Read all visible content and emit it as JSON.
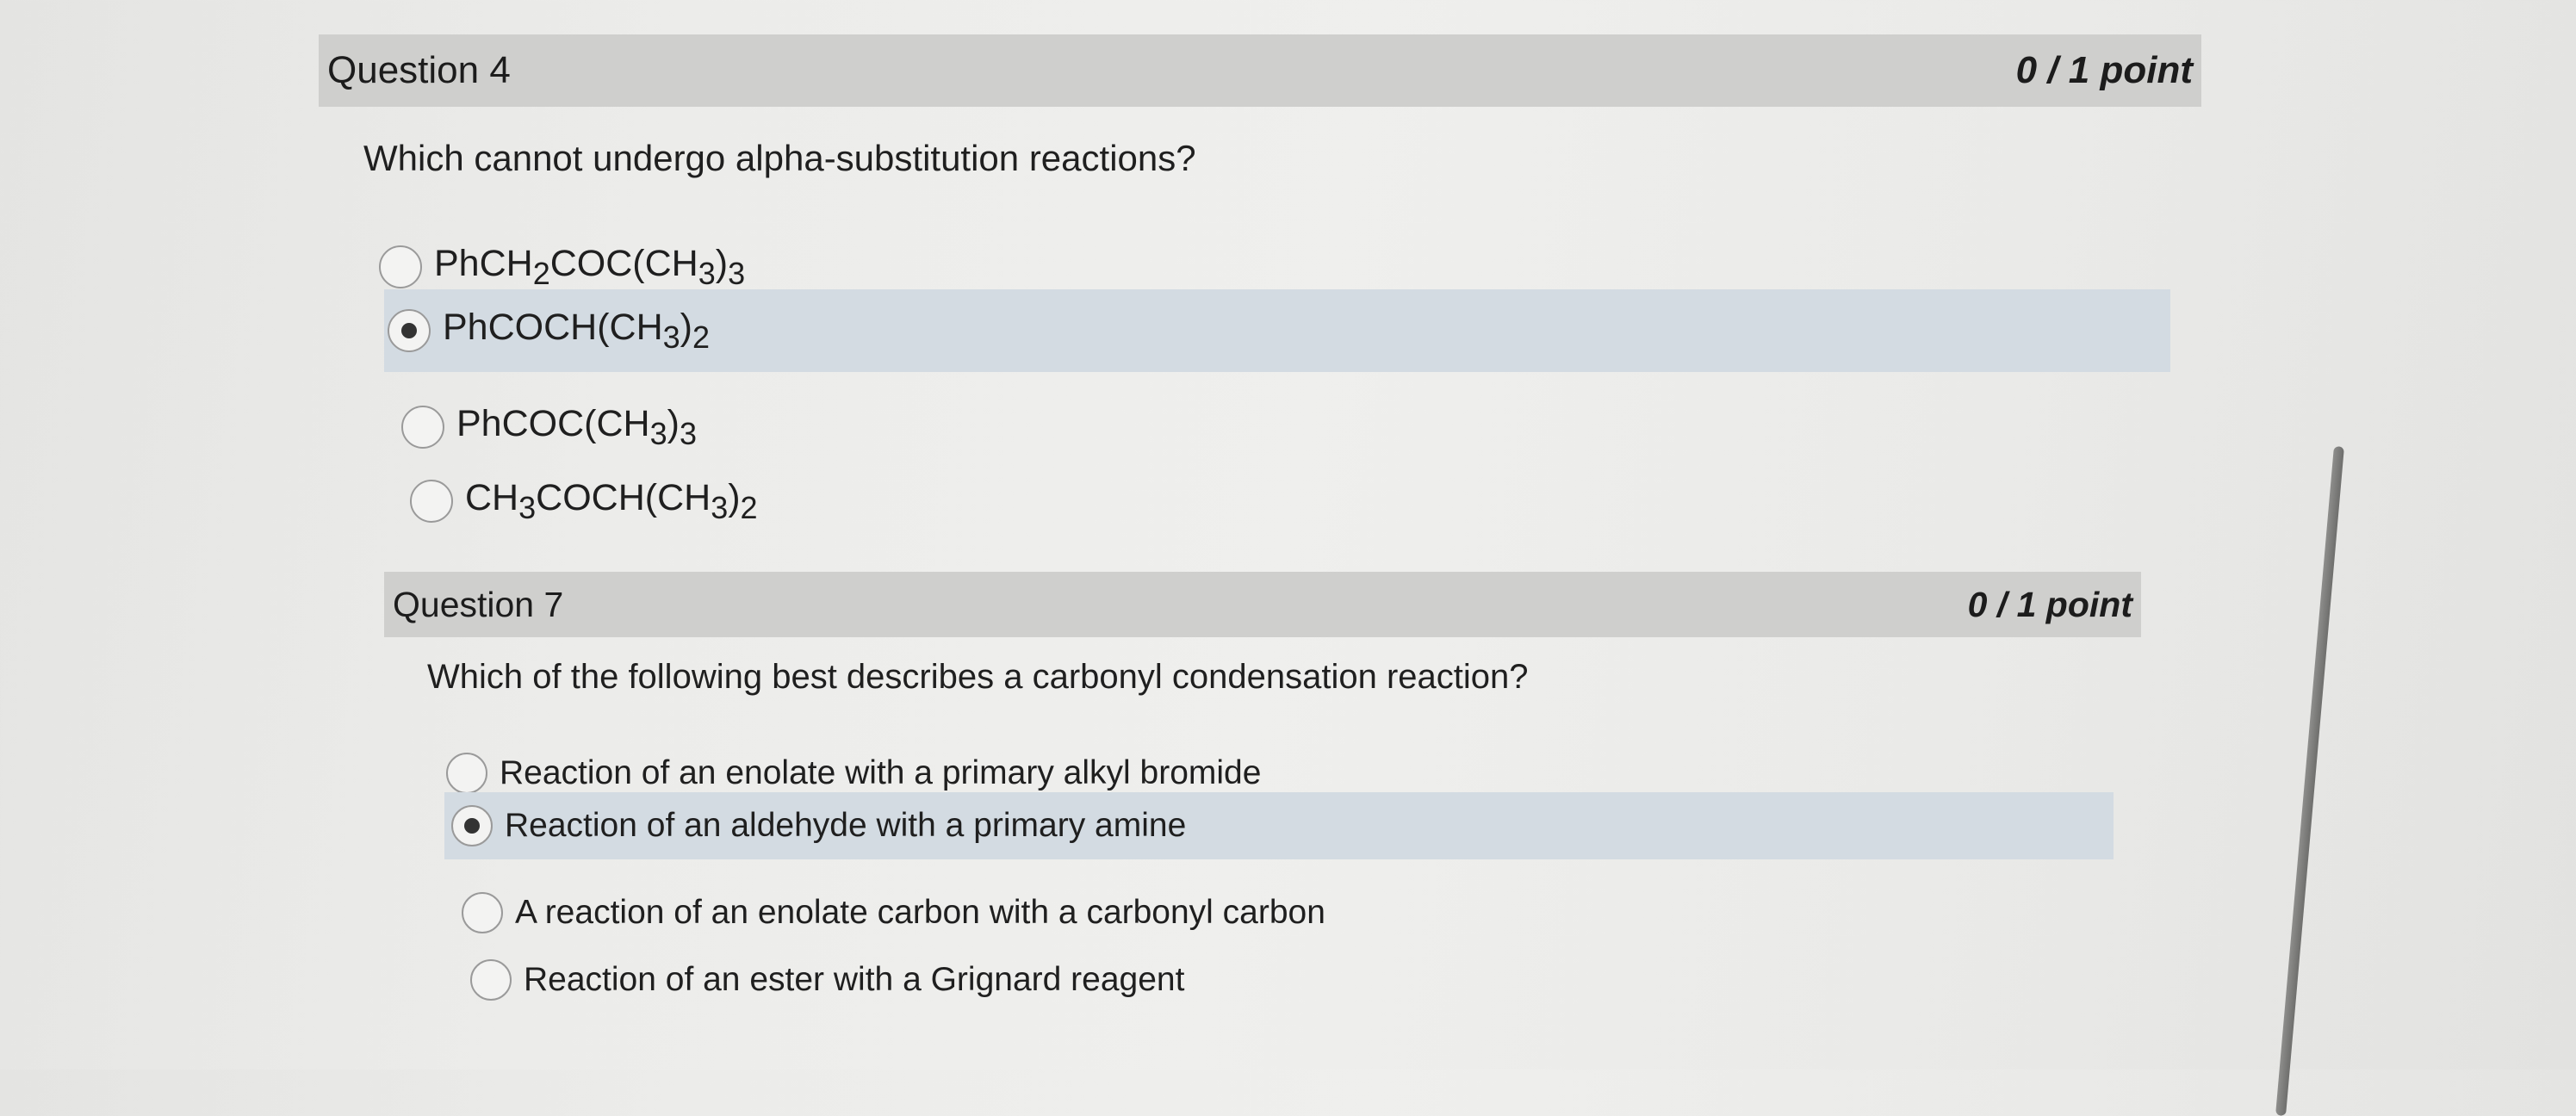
{
  "questions": [
    {
      "title": "Question 4",
      "points": "0 / 1 point",
      "prompt": "Which cannot undergo alpha-substitution reactions?",
      "options": [
        {
          "parts": [
            "PhCH",
            "2",
            "COC(CH",
            "3",
            ")",
            "3",
            "",
            "",
            "",
            ""
          ],
          "selected": false
        },
        {
          "parts": [
            "PhCOCH(CH",
            "3",
            ")",
            "2",
            "",
            "",
            "",
            "",
            "",
            ""
          ],
          "selected": true
        },
        {
          "parts": [
            "PhCOC(CH",
            "3",
            ")",
            "3",
            "",
            "",
            "",
            "",
            "",
            ""
          ],
          "selected": false
        },
        {
          "parts": [
            "CH",
            "3",
            "COCH(CH",
            "3",
            ")",
            "2",
            "",
            "",
            "",
            ""
          ],
          "selected": false
        }
      ]
    },
    {
      "title": "Question 7",
      "points": "0 / 1 point",
      "prompt": "Which of the following best describes a carbonyl condensation reaction?",
      "options": [
        {
          "label": "Reaction of an enolate with a primary alkyl bromide",
          "selected": false
        },
        {
          "label": "Reaction of an aldehyde with a primary amine",
          "selected": true
        },
        {
          "label": "A reaction of an enolate carbon with a carbonyl carbon",
          "selected": false
        },
        {
          "label": "Reaction of an ester with a Grignard reagent",
          "selected": false
        }
      ]
    }
  ],
  "colors": {
    "header_bg": "#cfcfcd",
    "selected_bg": "#d3dbe2"
  }
}
